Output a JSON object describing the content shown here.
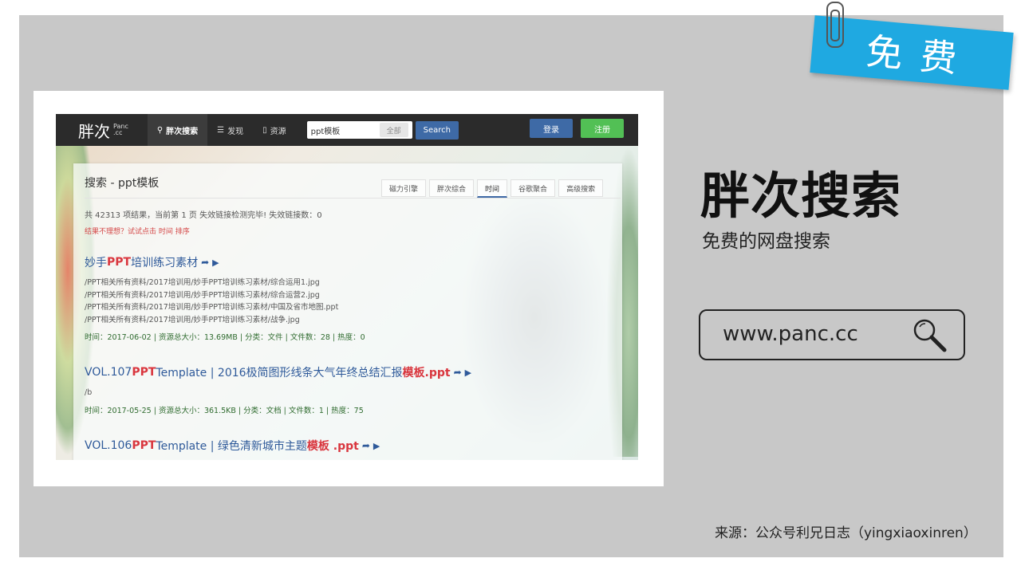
{
  "tag_label": "免费",
  "site": {
    "brand": "胖次",
    "brand_small_1": "Panc",
    "brand_small_2": ".cc",
    "nav": [
      {
        "label": "胖次搜索",
        "icon": "search-icon",
        "active": true
      },
      {
        "label": "发现",
        "icon": "list-icon",
        "active": false
      },
      {
        "label": "资源",
        "icon": "file-icon",
        "active": false
      }
    ],
    "search_value": "ppt模板",
    "search_scope": "全部",
    "search_button": "Search",
    "login": "登录",
    "register": "注册",
    "panel_title": "搜索 - ppt模板",
    "tabs": [
      "磁力引擎",
      "胖次综合",
      "时间",
      "谷歌聚合",
      "高级搜索"
    ],
    "active_tab": "时间",
    "summary": "共 42313 项结果，当前第 1 页  失效链接检测完毕! 失效链接数：0",
    "hint": "结果不理想？试试点击 时间 排序",
    "results": [
      {
        "title_pre": "妙手",
        "title_hl": "PPT",
        "title_post": "培训练习素材",
        "files": [
          "/PPT相关所有资料/2017培训用/妙手PPT培训练习素材/综合运用1.jpg",
          "/PPT相关所有资料/2017培训用/妙手PPT培训练习素材/综合运营2.jpg",
          "/PPT相关所有资料/2017培训用/妙手PPT培训练习素材/中国及省市地图.ppt",
          "/PPT相关所有资料/2017培训用/妙手PPT培训练习素材/战争.jpg"
        ],
        "meta": "时间：2017-06-02 | 资源总大小：13.69MB | 分类：文件 | 文件数：28 | 热度：0"
      },
      {
        "title_pre": "VOL.107 ",
        "title_hl": "PPT",
        "title_post": " Template  | 2016极简图形线条大气年终总结汇报",
        "title_hl2": "模板.ppt",
        "files": [
          "/b"
        ],
        "meta": "时间：2017-05-25 | 资源总大小：361.5KB | 分类：文档 | 文件数：1 | 热度：75"
      },
      {
        "title_pre": "VOL.106 ",
        "title_hl": "PPT",
        "title_post": " Template | 绿色清新城市主题",
        "title_hl2": "模板  .ppt",
        "files": [],
        "meta": ""
      }
    ]
  },
  "heading": "胖次搜索",
  "subheading": "免费的网盘搜索",
  "url": "www.panc.cc",
  "source_note": "来源：公众号利兄日志（yingxiaoxinren）",
  "colors": {
    "tag": "#1fa9e1",
    "navbar": "#2b2b2b",
    "link": "#2f5a9a",
    "highlight": "#d9363e",
    "login": "#3e6aa6",
    "register": "#52c055"
  }
}
